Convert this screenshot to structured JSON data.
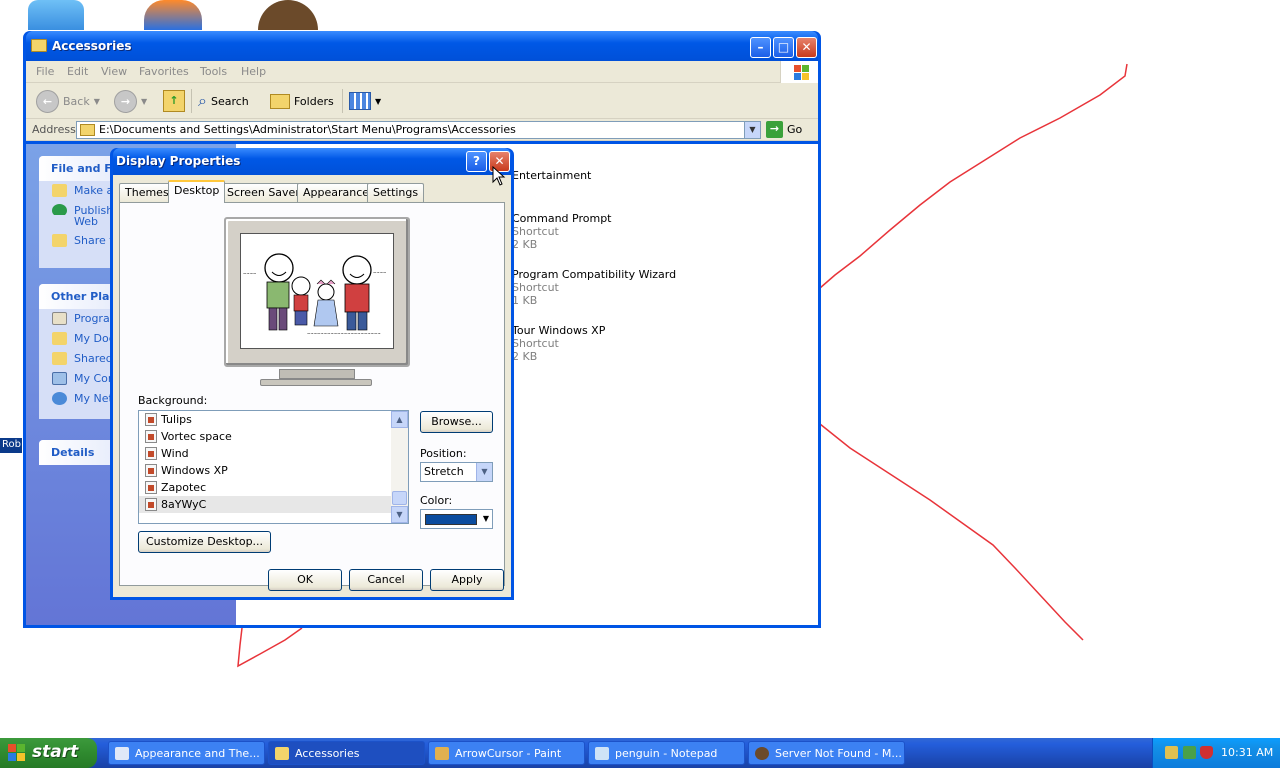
{
  "desktop": {
    "side_label": "Rob"
  },
  "explorer": {
    "title": "Accessories",
    "menu": [
      "File",
      "Edit",
      "View",
      "Favorites",
      "Tools",
      "Help"
    ],
    "toolbar": {
      "back": "Back",
      "search": "Search",
      "folders": "Folders"
    },
    "address": {
      "label": "Address",
      "path": "E:\\Documents and Settings\\Administrator\\Start Menu\\Programs\\Accessories",
      "go": "Go"
    },
    "taskpane": {
      "file_folder_title": "File and Fo",
      "file_folder_items": [
        "Make a",
        "Publish",
        "Web",
        "Share t"
      ],
      "other_places_title": "Other Plac",
      "other_places_items": [
        "Progra",
        "My Doc",
        "Shared",
        "My Con",
        "My Net"
      ],
      "details_title": "Details"
    },
    "files": [
      {
        "name": "Entertainment",
        "type": "",
        "size": ""
      },
      {
        "name": "Command Prompt",
        "type": "Shortcut",
        "size": "2 KB"
      },
      {
        "name": "Program Compatibility Wizard",
        "type": "Shortcut",
        "size": "1 KB"
      },
      {
        "name": "Tour Windows XP",
        "type": "Shortcut",
        "size": "2 KB"
      }
    ]
  },
  "dialog": {
    "title": "Display Properties",
    "help_btn": "?",
    "close_btn": "✕",
    "tabs": [
      "Themes",
      "Desktop",
      "Screen Saver",
      "Appearance",
      "Settings"
    ],
    "active_tab": "Desktop",
    "background_label": "Background:",
    "background_items": [
      "Tulips",
      "Vortec space",
      "Wind",
      "Windows XP",
      "Zapotec",
      "8aYWyC"
    ],
    "selected_background": "8aYWyC",
    "browse_btn": "Browse...",
    "position_label": "Position:",
    "position_value": "Stretch",
    "color_label": "Color:",
    "color_value": "#0b4c9e",
    "customize_btn": "Customize Desktop...",
    "ok_btn": "OK",
    "cancel_btn": "Cancel",
    "apply_btn": "Apply"
  },
  "taskbar": {
    "start": "start",
    "tasks": [
      "Appearance and The...",
      "Accessories",
      "ArrowCursor - Paint",
      "penguin - Notepad",
      "Server Not Found - M..."
    ],
    "clock": "10:31 AM"
  }
}
